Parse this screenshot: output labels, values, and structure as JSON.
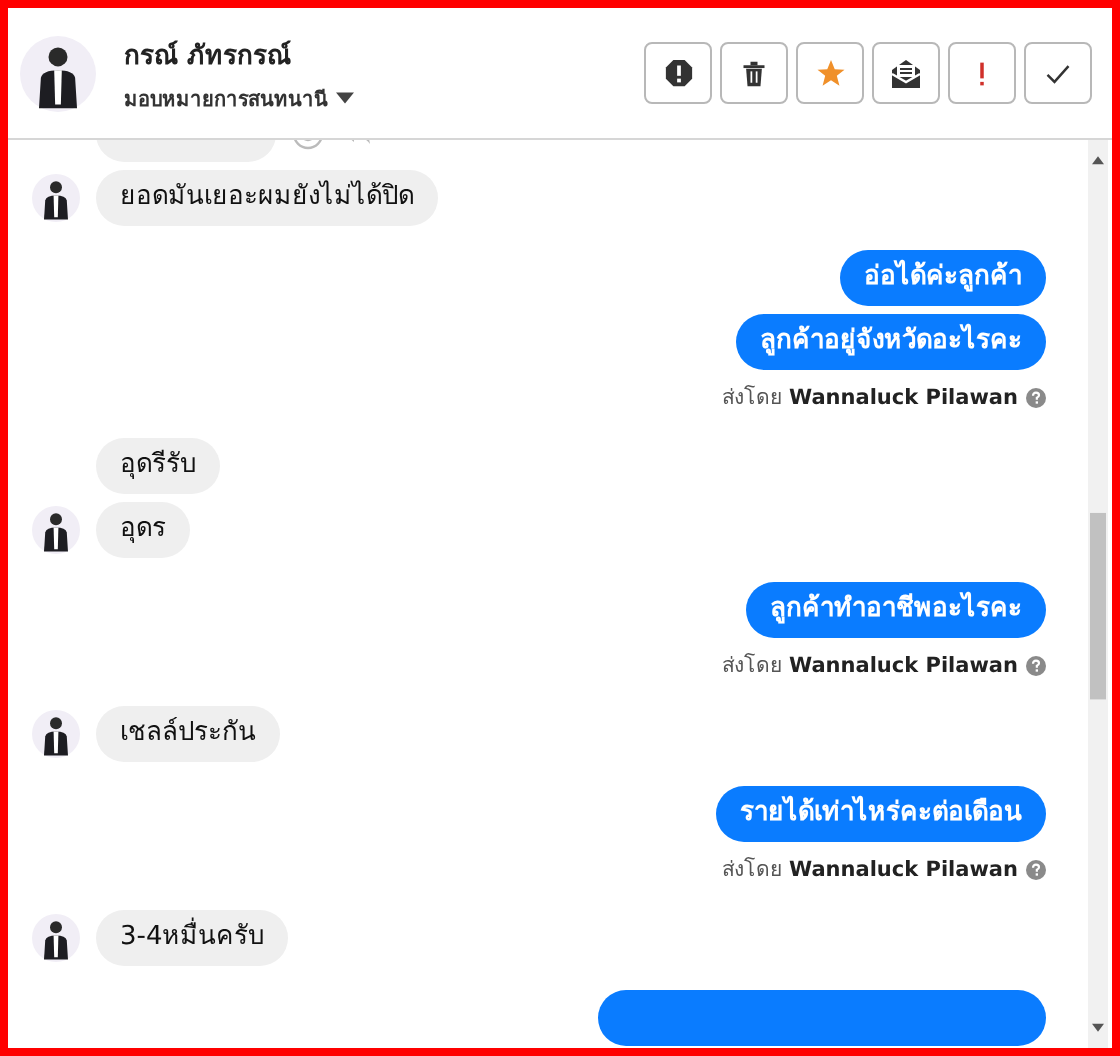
{
  "header": {
    "name": "กรณ์ ภัทรกรณ์",
    "assign_label": "มอบหมายการสนทนานี"
  },
  "actions": [
    {
      "kind": "spam"
    },
    {
      "kind": "delete"
    },
    {
      "kind": "star"
    },
    {
      "kind": "mail"
    },
    {
      "kind": "important"
    },
    {
      "kind": "done"
    }
  ],
  "messages": [
    {
      "kind": "incoming",
      "avatar": false,
      "hover_actions": true
    },
    {
      "kind": "incoming",
      "avatar": true,
      "text": "ยอดมันเยอะผมยังไม่ได้ปิด"
    },
    {
      "kind": "outgoing",
      "text": "อ่อได้ค่ะลูกค้า"
    },
    {
      "kind": "outgoing",
      "text": "ลูกค้าอยู่จังหวัดอะไรคะ"
    },
    {
      "kind": "sent_by",
      "prefix": "ส่งโดย",
      "agent": "Wannaluck Pilawan"
    },
    {
      "kind": "incoming",
      "avatar": false,
      "text": "อุดรีรับ"
    },
    {
      "kind": "incoming",
      "avatar": true,
      "text": "อุดร"
    },
    {
      "kind": "outgoing",
      "text": "ลูกค้าทำอาชีพอะไรคะ"
    },
    {
      "kind": "sent_by",
      "prefix": "ส่งโดย",
      "agent": "Wannaluck Pilawan"
    },
    {
      "kind": "incoming",
      "avatar": true,
      "text": "เชลล์ประกัน"
    },
    {
      "kind": "outgoing",
      "text": "รายได้เท่าไหร่คะต่อเดือน"
    },
    {
      "kind": "sent_by",
      "prefix": "ส่งโดย",
      "agent": "Wannaluck Pilawan"
    },
    {
      "kind": "incoming",
      "avatar": true,
      "text": "3-4หมื่นครับ"
    },
    {
      "kind": "outgoing"
    }
  ]
}
